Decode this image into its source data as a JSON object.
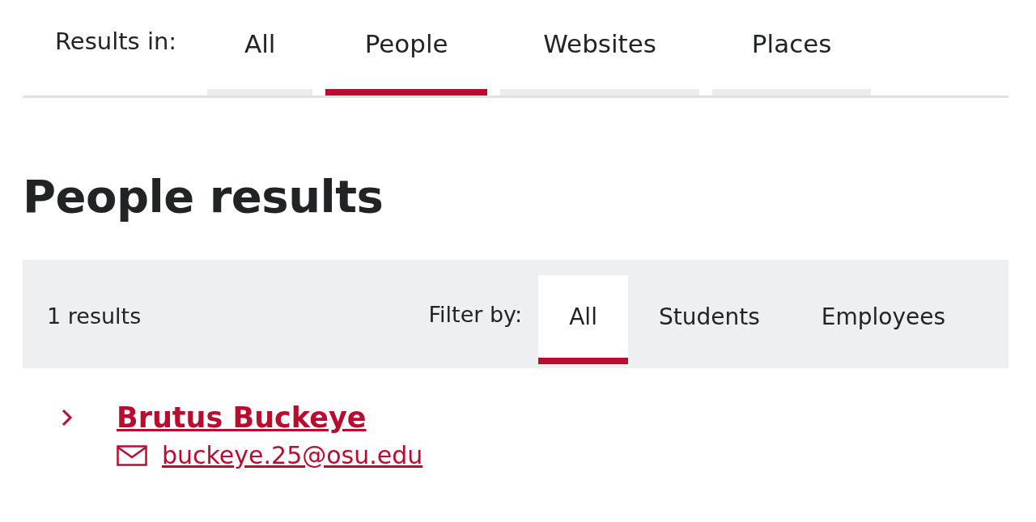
{
  "results_in": {
    "label": "Results in:",
    "tabs": [
      {
        "label": "All",
        "selected": false
      },
      {
        "label": "People",
        "selected": true
      },
      {
        "label": "Websites",
        "selected": false
      },
      {
        "label": "Places",
        "selected": false
      }
    ]
  },
  "heading": "People results",
  "filter_bar": {
    "count": "1 results",
    "label": "Filter by:",
    "tabs": [
      {
        "label": "All",
        "selected": true
      },
      {
        "label": "Students",
        "selected": false
      },
      {
        "label": "Employees",
        "selected": false
      }
    ]
  },
  "results": [
    {
      "name": "Brutus Buckeye",
      "email": "buckeye.25@osu.edu"
    }
  ]
}
